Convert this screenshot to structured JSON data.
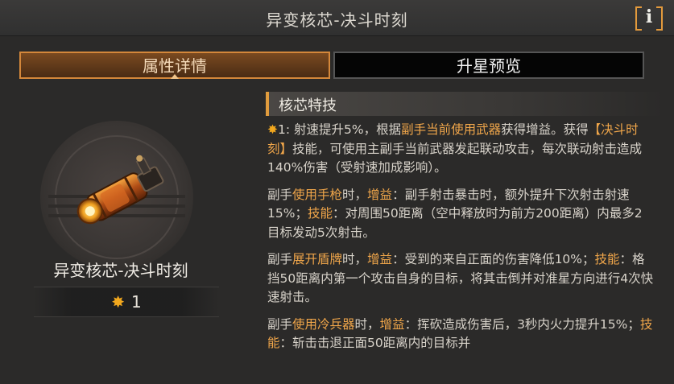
{
  "window": {
    "title": "异变核芯-决斗时刻",
    "info_label": "i"
  },
  "tabs": [
    {
      "label": "属性详情",
      "active": true
    },
    {
      "label": "升星预览",
      "active": false
    }
  ],
  "item": {
    "name": "异变核芯-决斗时刻",
    "star_level": "1",
    "icon": "pistol-weapon-icon"
  },
  "section": {
    "title": "核芯特技"
  },
  "paragraphs": [
    {
      "segments": [
        {
          "t": "1: 射速提升5%，根据",
          "s": "n"
        },
        {
          "t": "副手当前使用武器",
          "s": "hl"
        },
        {
          "t": "获得增益。获得",
          "s": "n"
        },
        {
          "t": "【决斗时刻】",
          "s": "hl"
        },
        {
          "t": "技能，可使用主副手当前武器发起联动攻击，每次联动射击造成140%伤害（受射速加成影响）。",
          "s": "n"
        }
      ]
    },
    {
      "segments": [
        {
          "t": "副手",
          "s": "n"
        },
        {
          "t": "使用手枪",
          "s": "hl"
        },
        {
          "t": "时，",
          "s": "n"
        },
        {
          "t": "增益",
          "s": "hl"
        },
        {
          "t": "：副手射击暴击时，额外提升下次射击射速15%；",
          "s": "n"
        },
        {
          "t": "技能",
          "s": "hl"
        },
        {
          "t": "：对周围50距离（空中释放时为前方200距离）内最多2目标发动5次射击。",
          "s": "n"
        }
      ]
    },
    {
      "segments": [
        {
          "t": "副手",
          "s": "n"
        },
        {
          "t": "展开盾牌",
          "s": "hl"
        },
        {
          "t": "时，",
          "s": "n"
        },
        {
          "t": "增益",
          "s": "hl"
        },
        {
          "t": "：受到的来自正面的伤害降低10%；",
          "s": "n"
        },
        {
          "t": "技能",
          "s": "hl"
        },
        {
          "t": "：格挡50距离内第一个攻击自身的目标，将其击倒并对准星方向进行4次快速射击。",
          "s": "n"
        }
      ]
    },
    {
      "segments": [
        {
          "t": "副手",
          "s": "n"
        },
        {
          "t": "使用冷兵器",
          "s": "hl"
        },
        {
          "t": "时，",
          "s": "n"
        },
        {
          "t": "增益",
          "s": "hl"
        },
        {
          "t": "：挥砍造成伤害后，3秒内火力提升15%；",
          "s": "n"
        },
        {
          "t": "技能",
          "s": "hl"
        },
        {
          "t": "：斩击击退正面50距离内的目标并",
          "s": "n"
        }
      ]
    }
  ],
  "colors": {
    "accent": "#e19c3d",
    "highlight": "#f0a64a",
    "star": "#f2a81e",
    "background": "#2b2a29"
  }
}
